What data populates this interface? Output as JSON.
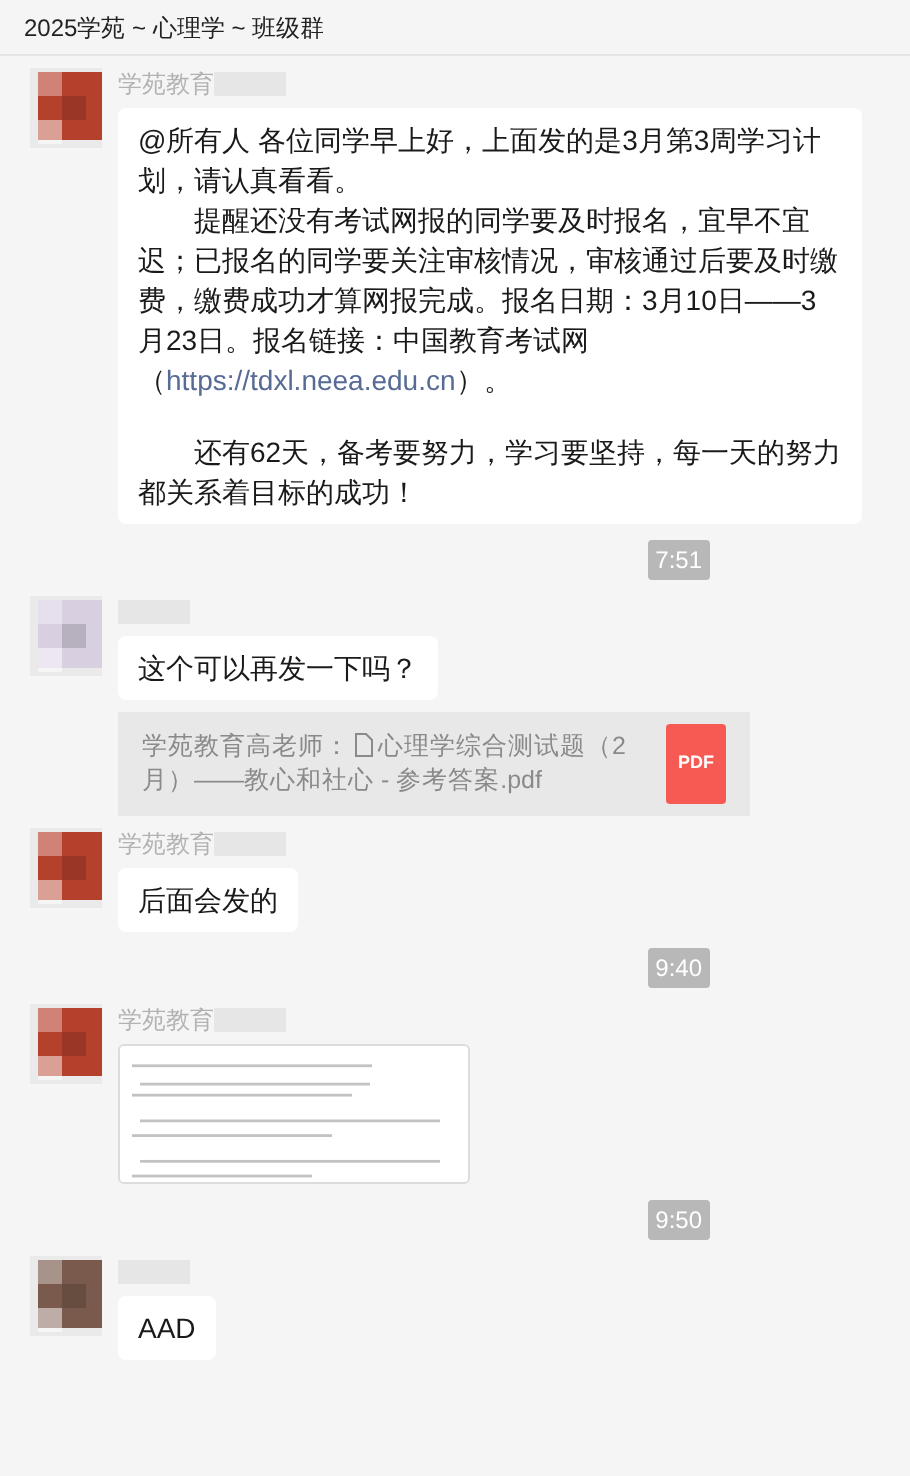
{
  "window": {
    "title": "2025学苑 ~ 心理学 ~ 班级群"
  },
  "messages": [
    {
      "kind": "text",
      "sender": "学苑教育",
      "avatar": {
        "color": "#b5402c"
      },
      "paragraphs": [
        {
          "text": "@所有人 各位同学早上好，上面发的是3月第3周学习计划，请认真看看。"
        },
        {
          "text": "　　提醒还没有考试网报的同学要及时报名，宜早不宜迟；已报名的同学要关注审核情况，审核通过后要及时缴费，缴费成功才算网报完成。报名日期：3月10日——3月23日。报名链接：中国教育考试网（",
          "link": "https://tdxl.neea.edu.cn",
          "after": "）。"
        },
        {
          "text": "　　还有62天，备考要努力，学习要坚持，每一天的努力都关系着目标的成功！"
        }
      ]
    },
    {
      "kind": "time",
      "text": "7:51"
    },
    {
      "kind": "text",
      "avatar": {
        "color": "#d8cfe0"
      },
      "paragraphs": [
        {
          "text": "这个可以再发一下吗？"
        }
      ],
      "quote": {
        "author": "学苑教育高老师：",
        "file": "心理学综合测试题（2月）——教心和社心 - 参考答案.pdf",
        "badge": "PDF"
      }
    },
    {
      "kind": "text",
      "sender": "学苑教育",
      "avatar": {
        "color": "#b5402c"
      },
      "paragraphs": [
        {
          "text": "后面会发的"
        }
      ]
    },
    {
      "kind": "time",
      "text": "9:40"
    },
    {
      "sender": "学苑教育",
      "avatar": {
        "color": "#b5402c"
      }
    },
    {
      "kind": "time",
      "text": "9:50"
    },
    {
      "kind": "text",
      "avatar": {
        "color": "#7a5a4c"
      },
      "paragraphs": [
        {
          "text": "AAD"
        }
      ]
    }
  ]
}
